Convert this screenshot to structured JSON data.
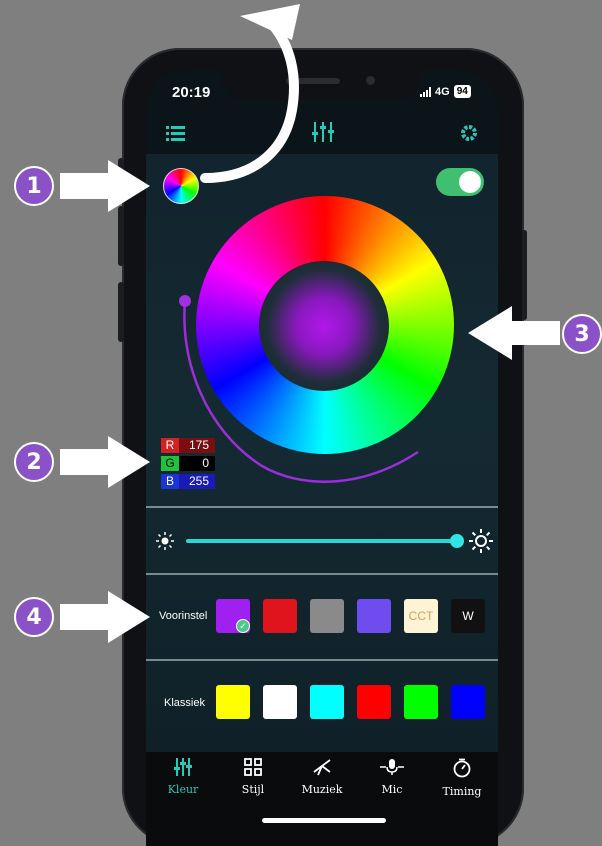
{
  "status": {
    "time": "20:19",
    "network": "4G",
    "battery": "94"
  },
  "topbar": {
    "menu_icon": "list-icon",
    "center_icon": "sliders-icon",
    "settings_icon": "gear-icon"
  },
  "rgb": {
    "r_label": "R",
    "r_value": "175",
    "g_label": "G",
    "g_value": "0",
    "b_label": "B",
    "b_value": "255"
  },
  "power": {
    "on": true
  },
  "brightness": {
    "level": 1.0
  },
  "presets": {
    "label": "Voorinstel",
    "swatches": [
      {
        "color": "#a020f0",
        "text": "",
        "selected": true
      },
      {
        "color": "#e0141c",
        "text": ""
      },
      {
        "color": "#8a8a8a",
        "text": ""
      },
      {
        "color": "#6e4cf0",
        "text": ""
      },
      {
        "color": "#fff3d6",
        "text": "CCT"
      },
      {
        "color": "#111111",
        "text": "W"
      }
    ]
  },
  "classic": {
    "label": "Klassiek",
    "swatches": [
      {
        "color": "#ffff00"
      },
      {
        "color": "#ffffff"
      },
      {
        "color": "#00ffff"
      },
      {
        "color": "#ff0000"
      },
      {
        "color": "#00ff00"
      },
      {
        "color": "#0000ff"
      }
    ]
  },
  "nav": [
    {
      "label": "Kleur",
      "icon": "sliders-icon",
      "active": true
    },
    {
      "label": "Stijl",
      "icon": "grid-icon"
    },
    {
      "label": "Muziek",
      "icon": "music-icon"
    },
    {
      "label": "Mic",
      "icon": "mic-icon"
    },
    {
      "label": "Timing",
      "icon": "timer-icon"
    }
  ],
  "callouts": [
    "1",
    "2",
    "3",
    "4"
  ],
  "colors": {
    "accent": "#27c9b8",
    "callout": "#8a52c6",
    "toggle_on": "#3fbf6f"
  }
}
